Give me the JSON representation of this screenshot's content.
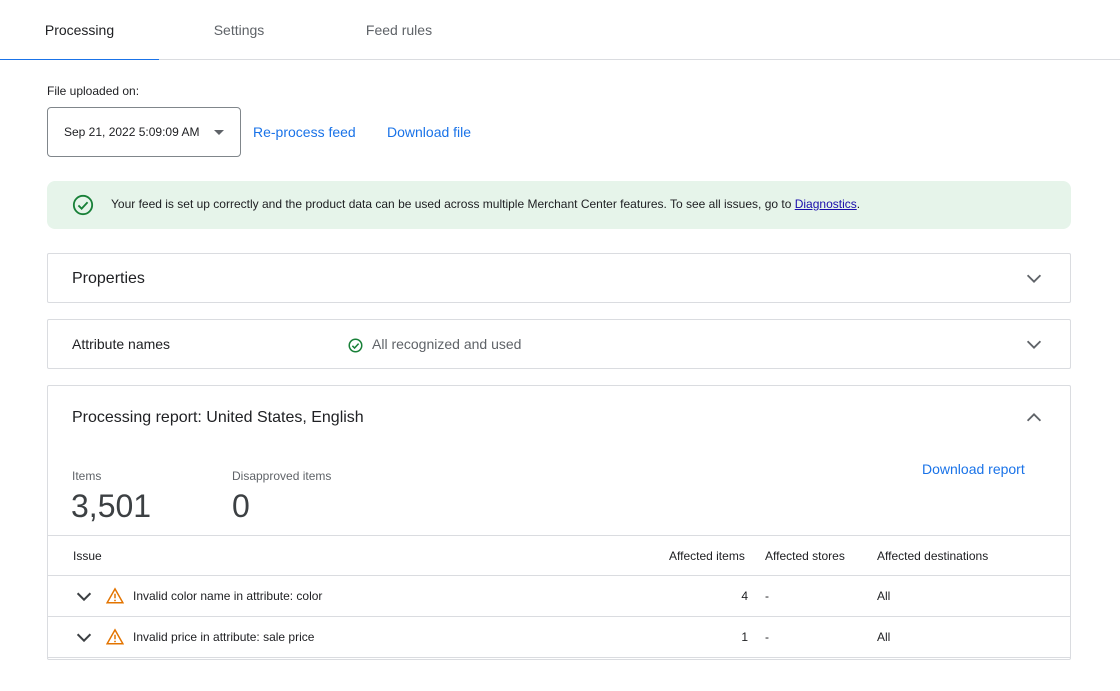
{
  "tabs": [
    {
      "label": "Processing",
      "active": true
    },
    {
      "label": "Settings",
      "active": false
    },
    {
      "label": "Feed rules",
      "active": false
    }
  ],
  "upload": {
    "label": "File uploaded on:",
    "selected": "Sep 21, 2022 5:09:09 AM",
    "reprocess_link": "Re-process feed",
    "download_link": "Download file"
  },
  "banner": {
    "text": "Your feed is set up correctly and the product data can be used across multiple Merchant Center features. To see all issues, go to ",
    "link": "Diagnostics",
    "suffix": ".",
    "icon": "check-circle-icon"
  },
  "properties": {
    "title": "Properties"
  },
  "attributes": {
    "title": "Attribute names",
    "status": "All recognized and used"
  },
  "report": {
    "title": "Processing report: United States, English",
    "download_link": "Download report",
    "items_label": "Items",
    "items_value": "3,501",
    "disapproved_label": "Disapproved items",
    "disapproved_value": "0",
    "columns": [
      "Issue",
      "Affected items",
      "Affected stores",
      "Affected destinations"
    ],
    "rows": [
      {
        "issue": "Invalid color name in attribute: color",
        "affected_items": "4",
        "affected_stores": "-",
        "affected_destinations": "All"
      },
      {
        "issue": "Invalid price in attribute: sale price",
        "affected_items": "1",
        "affected_stores": "-",
        "affected_destinations": "All"
      }
    ]
  },
  "colors": {
    "accent": "#1a73e8",
    "success": "#188038",
    "warning": "#e37400",
    "banner_bg": "#e6f4ea"
  }
}
